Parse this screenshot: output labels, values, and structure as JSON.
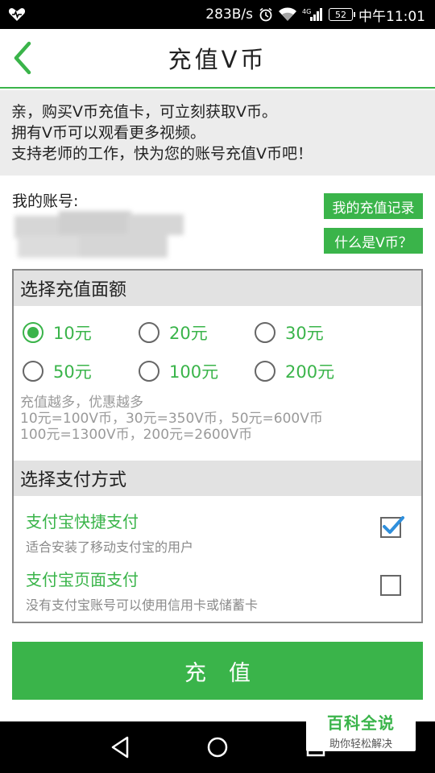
{
  "status_bar": {
    "speed": "283B/s",
    "network": "4G",
    "battery": "52",
    "time": "中午11:01"
  },
  "header": {
    "title": "充值V币"
  },
  "info": {
    "lines": [
      "亲，购买V币充值卡，可立刻获取V币。",
      "拥有V币可以观看更多视频。",
      "支持老师的工作，快为您的账号充值V币吧！"
    ]
  },
  "account": {
    "label": "我的账号:",
    "history_button": "我的充值记录",
    "what_button": "什么是V币？"
  },
  "amount_section": {
    "title": "选择充值面额",
    "options": [
      {
        "label": "10元",
        "checked": true
      },
      {
        "label": "20元",
        "checked": false
      },
      {
        "label": "30元",
        "checked": false
      },
      {
        "label": "50元",
        "checked": false
      },
      {
        "label": "100元",
        "checked": false
      },
      {
        "label": "200元",
        "checked": false
      }
    ],
    "promo": [
      "充值越多，优惠越多",
      "10元=100V币，30元=350V币，50元=600V币",
      "100元=1300V币，200元=2600V币"
    ]
  },
  "payment_section": {
    "title": "选择支付方式",
    "methods": [
      {
        "title": "支付宝快捷支付",
        "desc": "适合安装了移动支付宝的用户",
        "checked": true
      },
      {
        "title": "支付宝页面支付",
        "desc": "没有支付宝账号可以使用信用卡或储蓄卡",
        "checked": false
      }
    ]
  },
  "submit": {
    "label": "充值"
  },
  "watermark": {
    "title": "百科全说",
    "subtitle": "助你轻松解决"
  },
  "colors": {
    "accent": "#3ab44a",
    "status_bar": "#000000",
    "section_bg": "#e2e2e2"
  },
  "icons": [
    "heart-icon",
    "alarm-icon",
    "wifi-icon",
    "signal-icon",
    "battery-icon",
    "back-arrow-icon",
    "check-icon",
    "back-triangle-icon",
    "home-circle-icon",
    "recents-square-icon"
  ]
}
